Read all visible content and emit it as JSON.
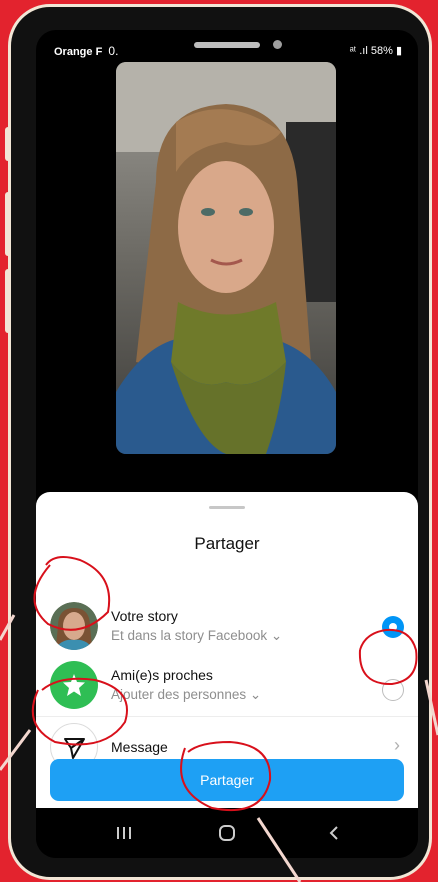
{
  "status_bar": {
    "carrier": "Orange F",
    "time": "0.",
    "battery": "58%"
  },
  "share_sheet": {
    "title": "Partager",
    "rows": [
      {
        "label": "Votre story",
        "sublabel": "Et dans la story Facebook",
        "selected": true,
        "icon": "profile-avatar"
      },
      {
        "label": "Ami(e)s proches",
        "sublabel": "Ajouter des personnes",
        "selected": false,
        "icon": "star-icon"
      },
      {
        "label": "Message",
        "icon": "paper-plane-icon"
      }
    ],
    "button_label": "Partager"
  },
  "nav_bar": [
    "recent-apps-icon",
    "home-icon",
    "back-icon"
  ],
  "colors": {
    "background": "#e3232e",
    "accent": "#0095f6",
    "close_friends_green": "#2fbe54",
    "annotation": "#d8101b"
  }
}
